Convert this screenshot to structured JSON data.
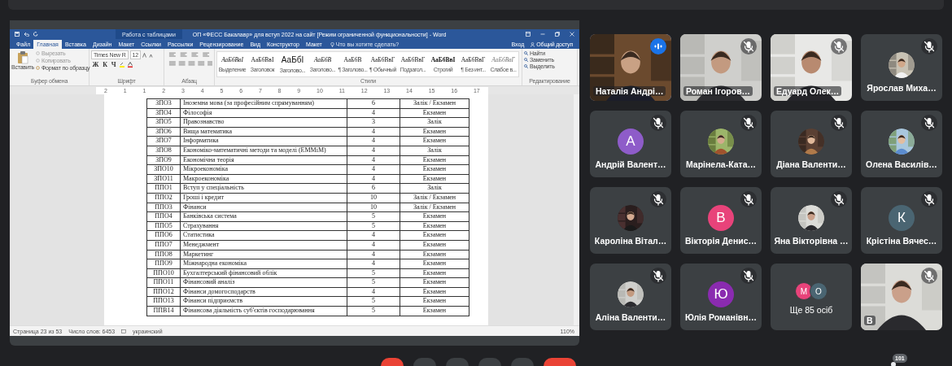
{
  "word": {
    "context_tab": "Работа с таблицами",
    "title": "ОП «ФЕСС Бакалавр» для вступ 2022 на сайт [Режим ограниченной функциональности] - Word",
    "tabs": [
      {
        "label": "Файл",
        "selected": false
      },
      {
        "label": "Главная",
        "selected": true
      },
      {
        "label": "Вставка",
        "selected": false
      },
      {
        "label": "Дизайн",
        "selected": false
      },
      {
        "label": "Макет",
        "selected": false
      },
      {
        "label": "Ссылки",
        "selected": false
      },
      {
        "label": "Рассылки",
        "selected": false
      },
      {
        "label": "Рецензирование",
        "selected": false
      },
      {
        "label": "Вид",
        "selected": false
      },
      {
        "label": "Конструктор",
        "selected": false
      },
      {
        "label": "Макет",
        "selected": false
      }
    ],
    "tell_me": "Что вы хотите сделать?",
    "sign_in": "Вход",
    "share": "Общий доступ",
    "clipboard": {
      "paste": "Вставить",
      "items": [
        {
          "label": "Вырезать",
          "disabled": true
        },
        {
          "label": "Копировать",
          "disabled": true
        },
        {
          "label": "Формат по образцу",
          "disabled": false
        }
      ],
      "label": "Буфер обмена"
    },
    "font": {
      "name": "Times New R",
      "size": "12",
      "format": [
        "Ж",
        "К",
        "Ч"
      ],
      "label": "Шрифт"
    },
    "paragraph": {
      "label": "Абзац"
    },
    "styles": {
      "items": [
        {
          "preview": "АаБбВвІ",
          "label": "Выделение"
        },
        {
          "preview": "АаБбВвІ",
          "label": "Заголовок"
        },
        {
          "preview": "АаБбІ",
          "label": "Заголово..."
        },
        {
          "preview": "АаБбВ",
          "label": "Заголово..."
        },
        {
          "preview": "АаБбВ",
          "label": "¶ Заголово..."
        },
        {
          "preview": "АаБбВвГ",
          "label": "¶ Обычный"
        },
        {
          "preview": "АаБбВвГ",
          "label": "Подзагол..."
        },
        {
          "preview": "АаБбВвІ",
          "label": "Строгий"
        },
        {
          "preview": "АаБбВвГ",
          "label": "¶ Без инт..."
        },
        {
          "preview": "АаБбВвГ",
          "label": "Слабое в..."
        }
      ],
      "label": "Стили"
    },
    "editing": {
      "items": [
        "Найти",
        "Заменить",
        "Выделить"
      ],
      "label": "Редактирование"
    },
    "ruler": [
      "2",
      "1",
      "1",
      "2",
      "3",
      "4",
      "5",
      "6",
      "7",
      "8",
      "9",
      "10",
      "11",
      "12",
      "13",
      "14",
      "15",
      "16",
      "17"
    ],
    "table": [
      [
        "ЗПО3",
        "Іноземна мова (за професійним спрямуванням)",
        "6",
        "Залік / Екзамен"
      ],
      [
        "ЗПО4",
        "Філософія",
        "4",
        "Екзамен"
      ],
      [
        "ЗПО5",
        "Правознавство",
        "3",
        "Залік"
      ],
      [
        "ЗПО6",
        "Вища математика",
        "4",
        "Екзамен"
      ],
      [
        "ЗПО7",
        "Інформатика",
        "4",
        "Екзамен"
      ],
      [
        "ЗПО8",
        "Економіко-математичні методи та моделі (ЕММіМ)",
        "4",
        "Залік"
      ],
      [
        "ЗПО9",
        "Економічна теорія",
        "4",
        "Екзамен"
      ],
      [
        "ЗПО10",
        "Мікроекономіка",
        "4",
        "Екзамен"
      ],
      [
        "ЗПО11",
        "Макроекономіка",
        "4",
        "Екзамен"
      ],
      [
        "ППО1",
        "Вступ у спеціальність",
        "6",
        "Залік"
      ],
      [
        "ППО2",
        "Гроші і кредит",
        "10",
        "Залік / Екзамен"
      ],
      [
        "ППО3",
        "Фінанси",
        "10",
        "Залік / Екзамен"
      ],
      [
        "ППО4",
        "Банківська система",
        "5",
        "Екзамен"
      ],
      [
        "ППО5",
        "Страхування",
        "5",
        "Екзамен"
      ],
      [
        "ППО6",
        "Статистика",
        "4",
        "Екзамен"
      ],
      [
        "ППО7",
        "Менеджмент",
        "4",
        "Екзамен"
      ],
      [
        "ППО8",
        "Маркетинг",
        "4",
        "Екзамен"
      ],
      [
        "ППО9",
        "Міжнародна економіка",
        "4",
        "Екзамен"
      ],
      [
        "ППО10",
        "Бухгалтерський фінансовий облік",
        "5",
        "Екзамен"
      ],
      [
        "ППО11",
        "Фінансовий аналіз",
        "5",
        "Екзамен"
      ],
      [
        "ППО12",
        "Фінанси домогосподарств",
        "4",
        "Екзамен"
      ],
      [
        "ППО13",
        "Фінанси підприємств",
        "5",
        "Екзамен"
      ],
      [
        "ППВ14",
        "Фінансова діяльність суб'єктів господарювання",
        "5",
        "Екзамен"
      ]
    ],
    "status": {
      "page": "Страница 23 из 53",
      "words": "Число слов: 6453",
      "language": "украинский",
      "zoom": "110%"
    }
  },
  "participants": [
    {
      "kind": "video",
      "name": "Наталія Андрі…",
      "muted": false,
      "speaking": true
    },
    {
      "kind": "video",
      "name": "Роман Ігоров…",
      "muted": true,
      "speaking": false
    },
    {
      "kind": "video",
      "name": "Едуард Олек…",
      "muted": true,
      "speaking": false
    },
    {
      "name": "Ярослав Миха…",
      "muted": true,
      "speaking": false
    },
    {
      "kind": "letter",
      "letter": "А",
      "color": "#8e5cc9",
      "name": "Андрій Валент…",
      "muted": true,
      "speaking": false
    },
    {
      "name": "Марінела-Ката…",
      "muted": true,
      "speaking": false
    },
    {
      "name": "Діана Валенти…",
      "muted": true,
      "speaking": false
    },
    {
      "name": "Олена Василів…",
      "muted": true,
      "speaking": false
    },
    {
      "name": "Кароліна Вітал…",
      "muted": true,
      "speaking": false
    },
    {
      "kind": "letter",
      "letter": "В",
      "color": "#e8437a",
      "name": "Вікторія Денис…",
      "muted": true,
      "speaking": false
    },
    {
      "name": "Яна Вікторівна …",
      "muted": true,
      "speaking": false
    },
    {
      "kind": "letter",
      "letter": "К",
      "color": "#4a6572",
      "name": "Крістіна Вячес…",
      "muted": true,
      "speaking": false
    },
    {
      "name": "Аліна Валенти…",
      "muted": true,
      "speaking": false
    },
    {
      "kind": "letter",
      "letter": "Ю",
      "color": "#8a2bb0",
      "name": "Юлія Романівн…",
      "muted": true,
      "speaking": false
    },
    {
      "kind": "more",
      "avatars": [
        {
          "letter": "М",
          "color": "#e8437a"
        },
        {
          "letter": "О",
          "color": "#4a6572"
        }
      ],
      "name": "Ще 85 осіб"
    },
    {
      "kind": "video",
      "name": "В",
      "muted": true,
      "speaking": false
    }
  ],
  "toolbar": {
    "controls": [
      {
        "kind": "mic"
      },
      {
        "kind": "camera"
      },
      {
        "kind": "captions"
      },
      {
        "kind": "present"
      },
      {
        "kind": "more"
      },
      {
        "kind": "hangup"
      }
    ],
    "people_count": "101"
  }
}
